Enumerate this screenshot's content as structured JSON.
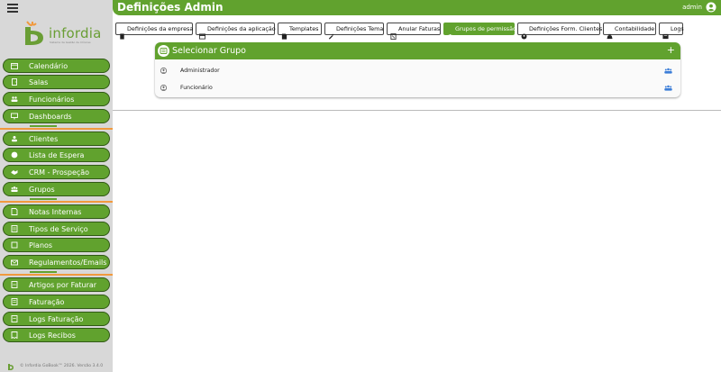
{
  "header": {
    "title": "Definições Admin",
    "user": "admin"
  },
  "sidebar": {
    "brand": "infordia",
    "brand_tagline": "Sistema de Gestão de Clínicas",
    "items": [
      {
        "label": "Calendário",
        "icon": "calendar-icon"
      },
      {
        "label": "Salas",
        "icon": "door-icon"
      },
      {
        "label": "Funcionários",
        "icon": "people-icon"
      },
      {
        "label": "Dashboards",
        "icon": "monitor-icon"
      },
      {
        "label": "Clientes",
        "icon": "clients-icon"
      },
      {
        "label": "Lista de Espera",
        "icon": "clock-icon"
      },
      {
        "label": "CRM - Prospeção",
        "icon": "handshake-icon"
      },
      {
        "label": "Grupos",
        "icon": "group-icon"
      },
      {
        "label": "Notas Internas",
        "icon": "note-icon"
      },
      {
        "label": "Tipos de Serviço",
        "icon": "list-icon"
      },
      {
        "label": "Planos",
        "icon": "plan-icon"
      },
      {
        "label": "Regulamentos/Emails",
        "icon": "email-icon"
      },
      {
        "label": "Artigos por Faturar",
        "icon": "article-icon"
      },
      {
        "label": "Faturação",
        "icon": "invoice-icon"
      },
      {
        "label": "Logs Faturação",
        "icon": "log-icon"
      },
      {
        "label": "Logs Recibos",
        "icon": "receipt-icon"
      }
    ],
    "footer": "© Infordia GoBook™ 2026. Versão 3.4.0"
  },
  "tabs": [
    {
      "label": "Definições da empresa",
      "icon": "building-icon",
      "active": false
    },
    {
      "label": "Definições da aplicação",
      "icon": "app-settings-icon",
      "active": false
    },
    {
      "label": "Templates",
      "icon": "template-icon",
      "active": false
    },
    {
      "label": "Definições Tema",
      "icon": "theme-icon",
      "active": false
    },
    {
      "label": "Anular Faturas",
      "icon": "cancel-invoice-icon",
      "active": false
    },
    {
      "label": "Grupos de permissão",
      "icon": "group-icon",
      "active": true
    },
    {
      "label": "Definições Form. Clientes",
      "icon": "client-form-icon",
      "active": false
    },
    {
      "label": "Contabilidade",
      "icon": "accounting-icon",
      "active": false
    },
    {
      "label": "Logs",
      "icon": "logs-icon",
      "active": false
    }
  ],
  "groups_panel": {
    "title": "Selecionar Grupo",
    "add_label": "+",
    "items": [
      "Administrador",
      "Funcionário"
    ]
  },
  "colors": {
    "primary": "#61a22e",
    "accent": "#f19a3e",
    "sidebar_bg": "#d8d8d8",
    "group_icon": "#3b7dd8"
  }
}
